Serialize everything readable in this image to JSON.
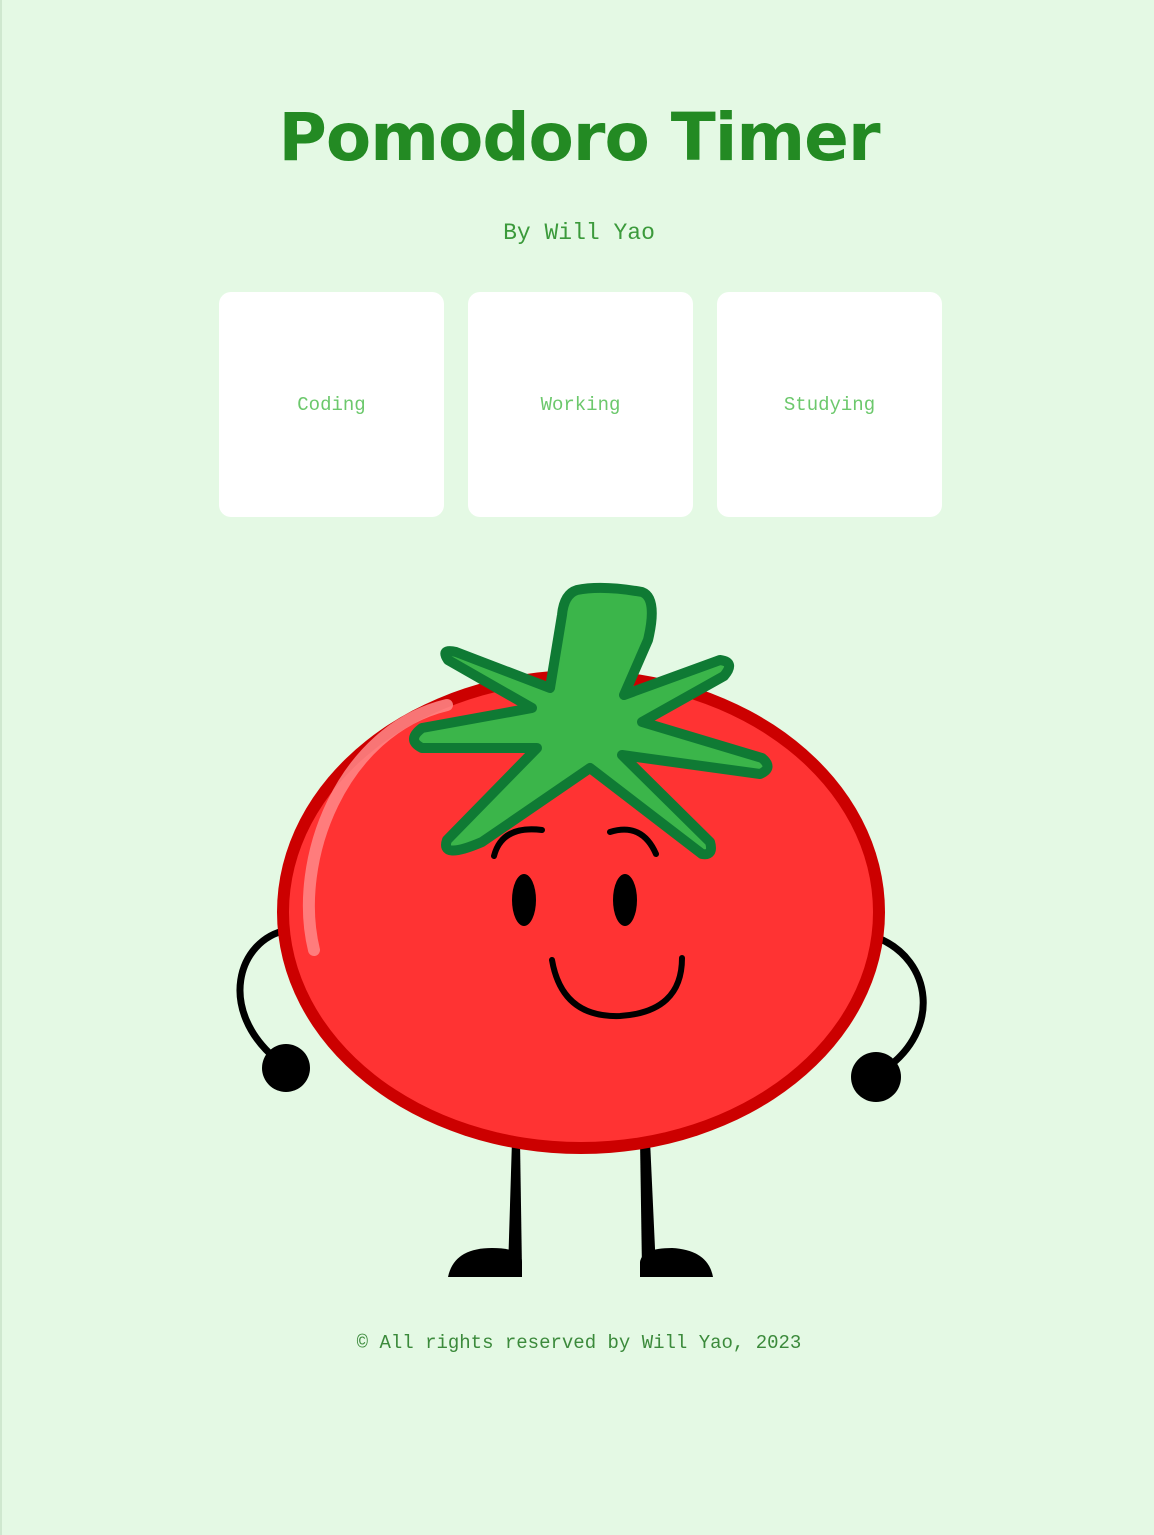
{
  "header": {
    "title": "Pomodoro Timer",
    "byline": "By Will Yao"
  },
  "modes": [
    {
      "label": "Coding"
    },
    {
      "label": "Working"
    },
    {
      "label": "Studying"
    }
  ],
  "illustration": {
    "icon": "tomato-mascot-icon"
  },
  "footer": {
    "text": "© All rights reserved by Will Yao, 2023"
  },
  "colors": {
    "background": "#e4f9e4",
    "title": "#238a23",
    "card_text": "#6cc86c",
    "tomato": "#ff3333",
    "leaf": "#3bb54a"
  }
}
